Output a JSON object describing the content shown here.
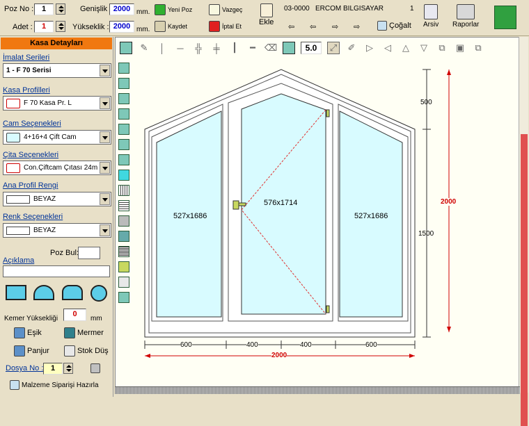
{
  "toolbar": {
    "poz_no_label": "Poz No :",
    "poz_no_value": "1",
    "adet_label": "Adet :",
    "adet_value": "1",
    "genislik_label": "Genişlik :",
    "genislik_value": "2000",
    "yukseklik_label": "Yükseklik :",
    "yukseklik_value": "2000",
    "unit": "mm.",
    "yeni_poz": "Yeni Poz",
    "kaydet": "Kaydet",
    "vazgec": "Vazgeç",
    "iptal_et": "İptal Et",
    "ekle": "Ekle",
    "code": "03-0000",
    "company": "ERCOM BILGISAYAR",
    "page": "1",
    "cogalt": "Çoğalt",
    "arsiv": "Arsiv",
    "raporlar": "Raporlar"
  },
  "left": {
    "title": "Kasa Detayları",
    "imalat_label": "İmalat Serileri",
    "imalat_value": "1 - F 70 Serisi",
    "kasa_label": "Kasa Profilleri",
    "kasa_value": "F 70 Kasa Pr. L",
    "cam_label": "Cam Seçenekleri",
    "cam_value": "4+16+4 Çift Cam",
    "cita_label": "Çita Seçenekleri",
    "cita_value": "Con.Çiftcam Çıtası 24m",
    "ana_renk_label": "Ana Profil Rengi",
    "ana_renk_value": "BEYAZ",
    "renk_label": "Renk Seçenekleri",
    "renk_value": "BEYAZ",
    "poz_bul_label": "Poz Bul:",
    "aciklama_label": "Açıklama",
    "kemer_label": "Kemer Yüksekliği",
    "kemer_value": "0",
    "kemer_unit": "mm",
    "esik": "Eşik",
    "mermer": "Mermer",
    "panjur": "Panjur",
    "stok_dus": "Stok Düş",
    "dosya_label": "Dosya No :",
    "dosya_value": "1",
    "malzeme": "Malzeme Siparişi Hazırla"
  },
  "drawing": {
    "zoom_value": "5.0",
    "pane_left": "527x1686",
    "pane_center": "576x1714",
    "pane_right": "527x1686",
    "dim_top_right": "500",
    "dim_side_right": "1500",
    "dim_total_height": "2000",
    "dim_bottom_1": "600",
    "dim_bottom_2": "400",
    "dim_bottom_3": "400",
    "dim_bottom_4": "600",
    "dim_total_width": "2000"
  },
  "colors": {
    "glass": "#d8fbff",
    "accent": "#f07810",
    "dim_red": "#d00000"
  }
}
